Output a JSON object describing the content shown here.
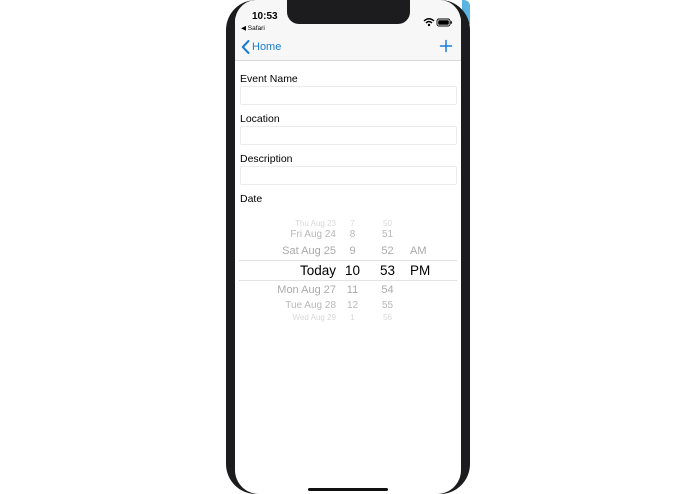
{
  "status_bar": {
    "time": "10:53",
    "back_app": "◀ Safari",
    "icons": [
      "wifi-icon",
      "battery-icon"
    ]
  },
  "nav": {
    "back_label": "Home",
    "back_icon": "chevron-left-icon",
    "add_icon": "plus-icon",
    "accent_color": "#1a7ed4"
  },
  "form": {
    "event_name": {
      "label": "Event Name",
      "value": "",
      "placeholder": ""
    },
    "location": {
      "label": "Location",
      "value": "",
      "placeholder": ""
    },
    "description": {
      "label": "Description",
      "value": "",
      "placeholder": ""
    },
    "date": {
      "label": "Date"
    }
  },
  "date_picker": {
    "days": [
      "Thu Aug 23",
      "Fri Aug 24",
      "Sat Aug 25",
      "Today",
      "Mon Aug 27",
      "Tue Aug 28",
      "Wed Aug 29"
    ],
    "hours": [
      "7",
      "8",
      "9",
      "10",
      "11",
      "12",
      "1"
    ],
    "minutes": [
      "50",
      "51",
      "52",
      "53",
      "54",
      "55",
      "56"
    ],
    "periods": [
      "AM",
      "PM"
    ],
    "selected": {
      "day": "Today",
      "hour": "10",
      "minute": "53",
      "period": "PM"
    }
  }
}
